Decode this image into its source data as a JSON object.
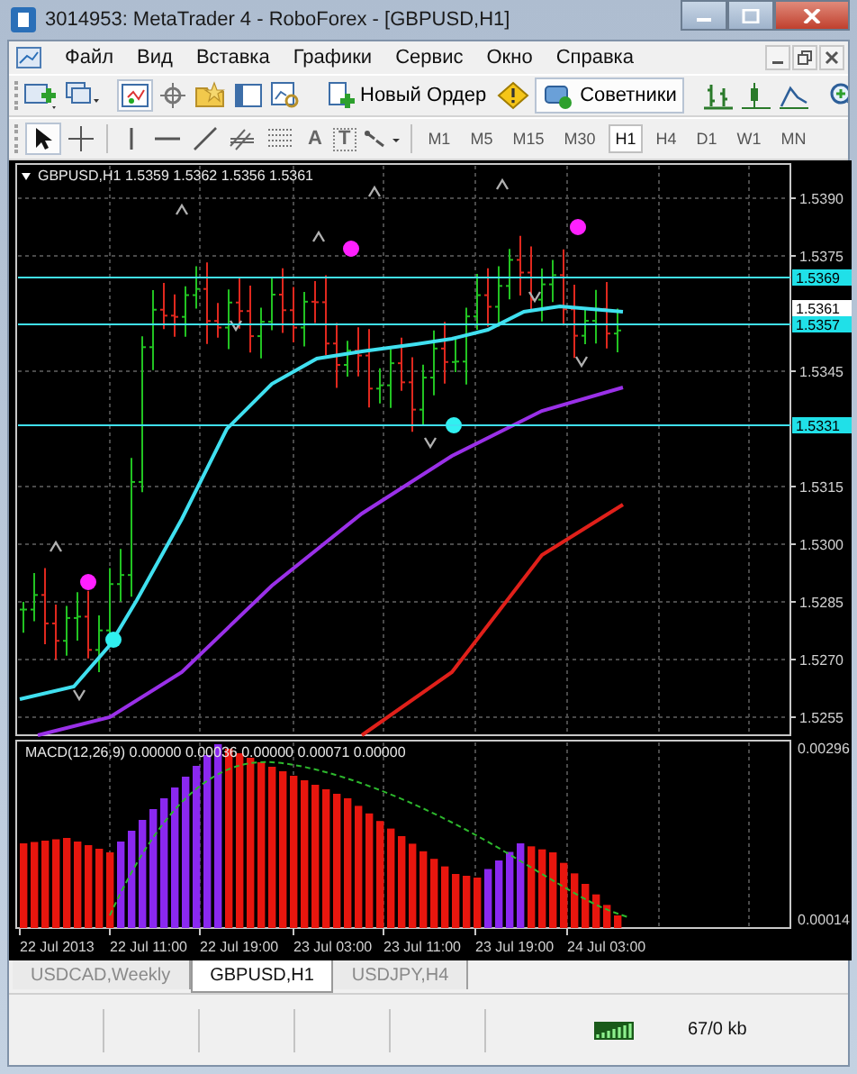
{
  "window": {
    "title": "3014953: MetaTrader 4 - RoboForex - [GBPUSD,H1]"
  },
  "menu": [
    "Файл",
    "Вид",
    "Вставка",
    "Графики",
    "Сервис",
    "Окно",
    "Справка"
  ],
  "toolbar": {
    "new_order": "Новый Ордер",
    "experts": "Советники",
    "text_tool": "A",
    "label_tool": "T"
  },
  "timeframes": [
    {
      "label": "M1",
      "selected": false
    },
    {
      "label": "M5",
      "selected": false
    },
    {
      "label": "M15",
      "selected": false
    },
    {
      "label": "M30",
      "selected": false
    },
    {
      "label": "H1",
      "selected": true
    },
    {
      "label": "H4",
      "selected": false
    },
    {
      "label": "D1",
      "selected": false
    },
    {
      "label": "W1",
      "selected": false
    },
    {
      "label": "MN",
      "selected": false
    }
  ],
  "chart": {
    "header": "GBPUSD,H1  1.5359 1.5362 1.5356 1.5361",
    "price_labels": [
      "1.5390",
      "1.5375",
      "1.5345",
      "1.5315",
      "1.5300",
      "1.5285",
      "1.5270",
      "1.5255"
    ],
    "level_tags": [
      {
        "text": "1.5369",
        "kind": "line"
      },
      {
        "text": "1.5361",
        "kind": "bid"
      },
      {
        "text": "1.5357",
        "kind": "line"
      },
      {
        "text": "1.5331",
        "kind": "line"
      }
    ],
    "indicator": {
      "header": "MACD(12,26,9) 0.00000 0.00036 0.00000 0.00071 0.00000",
      "labels": [
        "0.00296",
        "0.00014"
      ]
    },
    "time_labels": [
      "22 Jul 2013",
      "22 Jul 11:00",
      "22 Jul 19:00",
      "23 Jul 03:00",
      "23 Jul 11:00",
      "23 Jul 19:00",
      "24 Jul 03:00"
    ]
  },
  "tabs": [
    {
      "label": "USDCAD,Weekly",
      "selected": false
    },
    {
      "label": "GBPUSD,H1",
      "selected": true
    },
    {
      "label": "USDJPY,H4",
      "selected": false
    }
  ],
  "status_bar": {
    "traffic": "67/0 kb"
  }
}
